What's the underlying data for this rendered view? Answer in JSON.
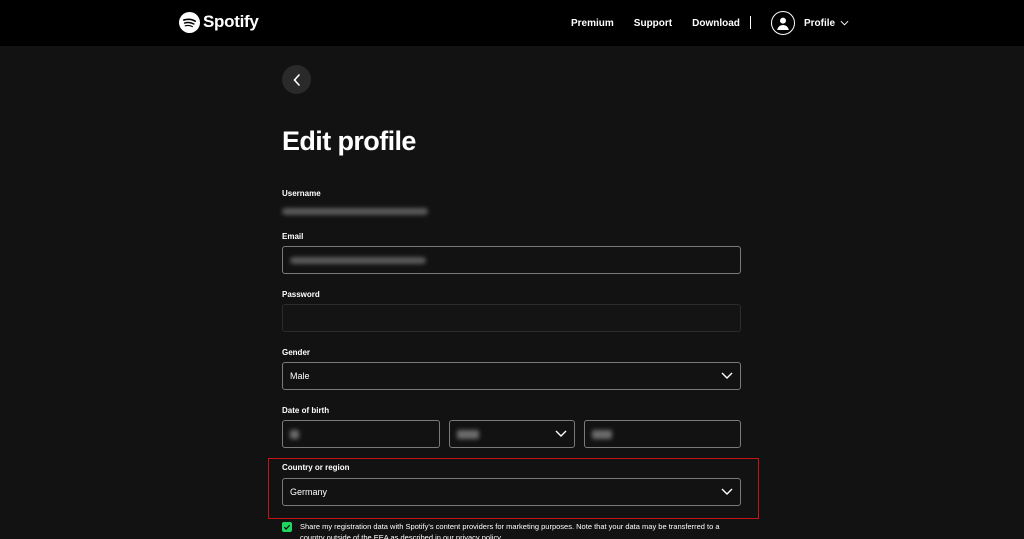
{
  "brand": {
    "name": "Spotify"
  },
  "nav": {
    "links": [
      "Premium",
      "Support",
      "Download"
    ],
    "profile_label": "Profile"
  },
  "page": {
    "title": "Edit profile"
  },
  "form": {
    "username": {
      "label": "Username"
    },
    "email": {
      "label": "Email"
    },
    "password": {
      "label": "Password",
      "value": ""
    },
    "gender": {
      "label": "Gender",
      "value": "Male"
    },
    "dob": {
      "label": "Date of birth"
    },
    "country": {
      "label": "Country or region",
      "value": "Germany"
    }
  },
  "consent": {
    "checked": true,
    "text": "Share my registration data with Spotify's content providers for marketing purposes. Note that your data may be transferred to a country outside of the EEA as described in our privacy policy."
  },
  "colors": {
    "background": "#121212",
    "nav_background": "#000000",
    "accent_green": "#1ed760",
    "highlight_red": "#c41414"
  }
}
